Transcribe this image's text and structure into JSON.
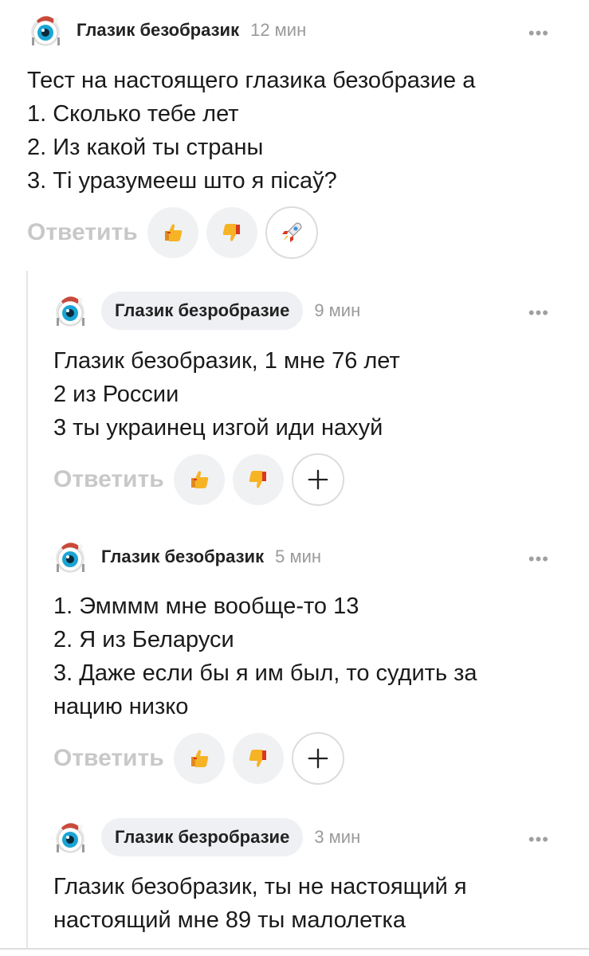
{
  "comments": [
    {
      "author": "Глазик безобразик",
      "time": "12 мин",
      "lines": [
        "Тест на настоящего глазика безобразие а",
        "1. Сколько тебе лет",
        "2. Из какой ты страны",
        "3. Ті уразумееш што я пісаў?"
      ],
      "reply_label": "Ответить",
      "more": "•••",
      "reactions": [
        "thumbs-up-icon",
        "thumbs-down-icon",
        "rocket-icon"
      ]
    },
    {
      "author": "Глазик безробразие",
      "time": "9 мин",
      "lines": [
        "Глазик безобразик, 1 мне 76 лет",
        "2 из России",
        "3 ты украинец изгой иди нахуй"
      ],
      "reply_label": "Ответить",
      "more": "•••",
      "reactions": [
        "thumbs-up-icon",
        "thumbs-down-icon",
        "plus-icon"
      ]
    },
    {
      "author": "Глазик безобразик",
      "time": "5 мин",
      "lines": [
        "1. Эмммм мне вообще-то 13",
        "2. Я из Беларуси",
        "3. Даже если бы я им был, то судить за",
        "нацию низко"
      ],
      "reply_label": "Ответить",
      "more": "•••",
      "reactions": [
        "thumbs-up-icon",
        "thumbs-down-icon",
        "plus-icon"
      ]
    },
    {
      "author": "Глазик безробразие",
      "time": "3 мин",
      "lines": [
        "Глазик безобразик, ты не настоящий я",
        "настоящий мне 89 ты малолетка"
      ],
      "more": "•••"
    }
  ],
  "colors": {
    "eye_iris": "#1aa5d4",
    "hat_red": "#c94a3a",
    "thumb_yellow": "#f6b324",
    "reply_gray": "#c8c8c8"
  }
}
